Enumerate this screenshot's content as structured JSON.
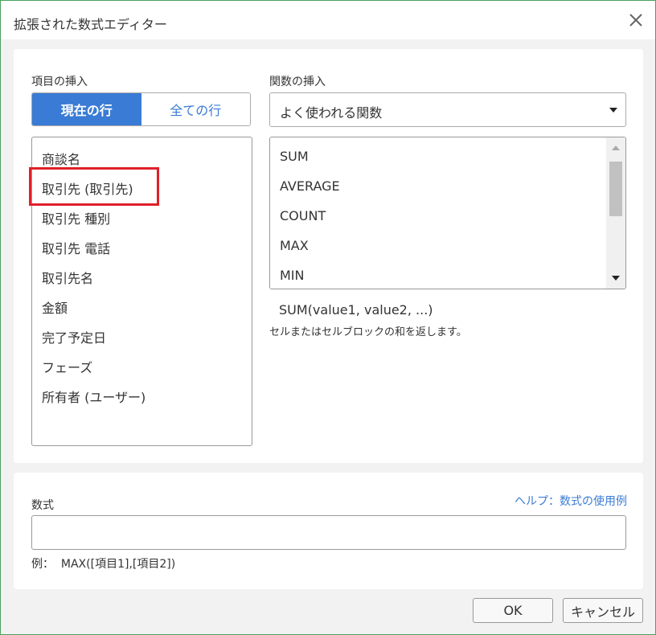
{
  "window": {
    "title": "拡張された数式エディター",
    "close_icon": "close-icon"
  },
  "insert_field": {
    "label": "項目の挿入",
    "toggle": {
      "current_row": "現在の行",
      "all_rows": "全ての行",
      "selected": "現在の行"
    },
    "items": [
      "商談名",
      "取引先 (取引先)",
      "取引先 種別",
      "取引先 電話",
      "取引先名",
      "金額",
      "完了予定日",
      "フェーズ",
      "所有者 (ユーザー)"
    ],
    "highlighted_item": "取引先 (取引先)",
    "highlight_color": "#e0202a"
  },
  "insert_function": {
    "label": "関数の挿入",
    "select_value": "よく使われる関数",
    "functions": [
      "SUM",
      "AVERAGE",
      "COUNT",
      "MAX",
      "MIN"
    ],
    "signature": "SUM(value1, value2, ...)",
    "description": "セルまたはセルブロックの和を返します。"
  },
  "formula": {
    "label": "数式",
    "help_link": "ヘルプ：数式の使用例",
    "value": "",
    "example": "例：  MAX([項目1],[項目2])"
  },
  "buttons": {
    "ok": "OK",
    "cancel": "キャンセル"
  },
  "colors": {
    "accent": "#3a7bd5",
    "window_border": "#4aa05a"
  }
}
